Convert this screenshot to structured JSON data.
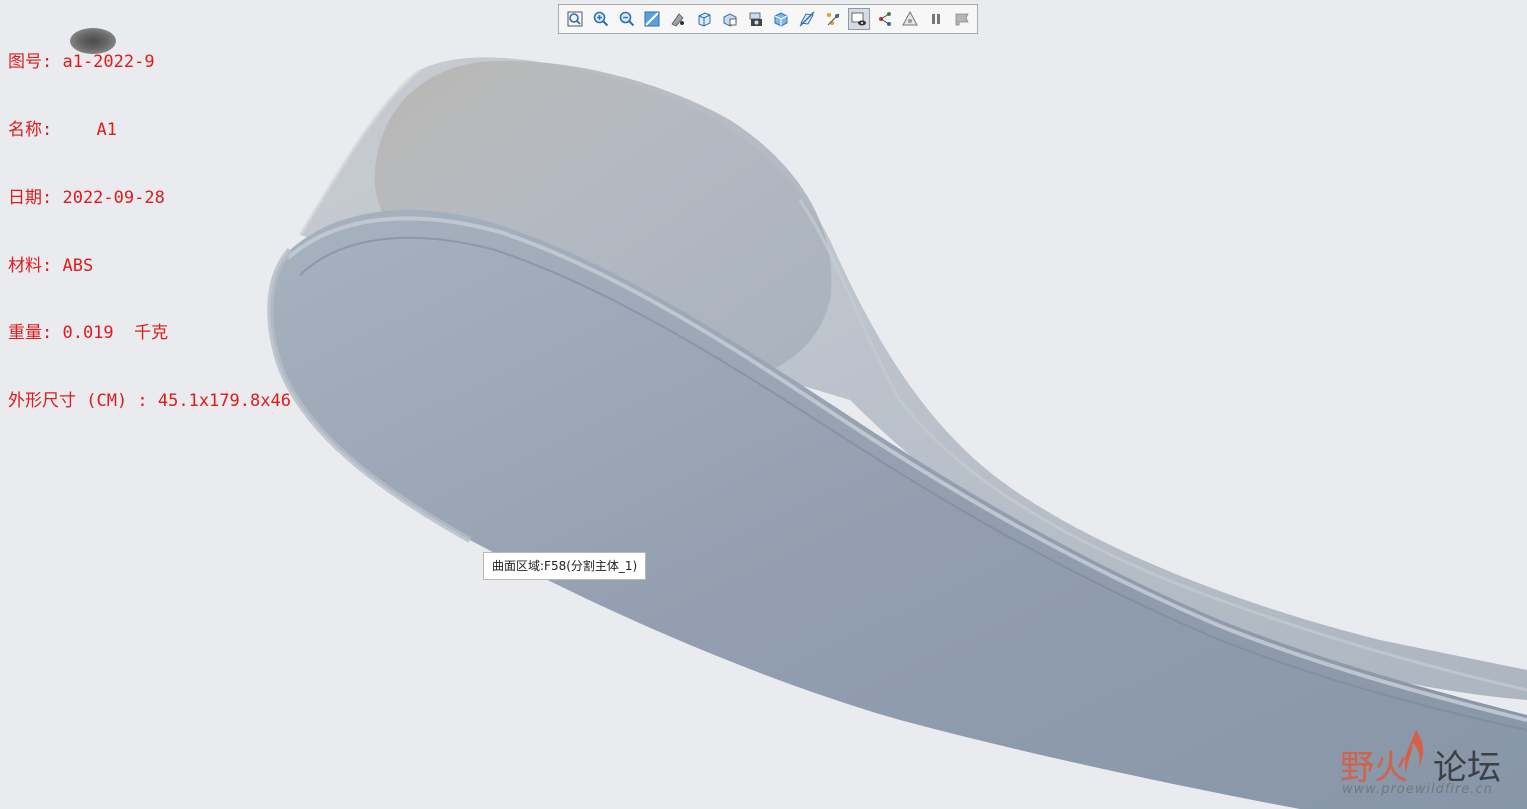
{
  "model_info": {
    "drawing_no": "图号: a1-2022-9",
    "name_prefix": "名称: ",
    "name_suffix": "A1",
    "date": "日期: 2022-09-28",
    "material": "材料: ABS",
    "weight": "重量: 0.019  千克",
    "dimensions": "外形尺寸 (CM) : 45.1x179.8x46"
  },
  "toolbar": {
    "buttons": [
      {
        "name": "refit-view",
        "icon": "zoom-fit-icon"
      },
      {
        "name": "zoom-in",
        "icon": "zoom-in-icon"
      },
      {
        "name": "zoom-out",
        "icon": "zoom-out-icon"
      },
      {
        "name": "repaint",
        "icon": "repaint-icon"
      },
      {
        "name": "display-style",
        "icon": "shading-icon"
      },
      {
        "name": "saved-orientations",
        "icon": "cube-orientation-icon"
      },
      {
        "name": "view-manager",
        "icon": "view-manager-icon"
      },
      {
        "name": "perspective",
        "icon": "camera-icon"
      },
      {
        "name": "section",
        "icon": "section-cube-icon"
      },
      {
        "name": "datum-display",
        "icon": "datum-plane-icon"
      },
      {
        "name": "annotation-display",
        "icon": "annotation-icon"
      },
      {
        "name": "display-filter",
        "icon": "eye-filter-icon",
        "active": true
      },
      {
        "name": "spin-center",
        "icon": "spin-center-icon"
      },
      {
        "name": "appearance",
        "icon": "triangle-appearance-icon"
      },
      {
        "name": "pause",
        "icon": "pause-icon"
      },
      {
        "name": "animation",
        "icon": "flag-icon"
      }
    ]
  },
  "tooltip": {
    "text": "曲面区域:F58(分割主体_1)"
  },
  "watermark": {
    "part1": "野火",
    "part2": "论坛",
    "url": "www.proewildfire.cn"
  },
  "colors": {
    "background": "#e9ebef",
    "model_body": "#8f9cac",
    "info_text": "#e01b1b",
    "toolbar_bg": "#f7f7f7"
  }
}
